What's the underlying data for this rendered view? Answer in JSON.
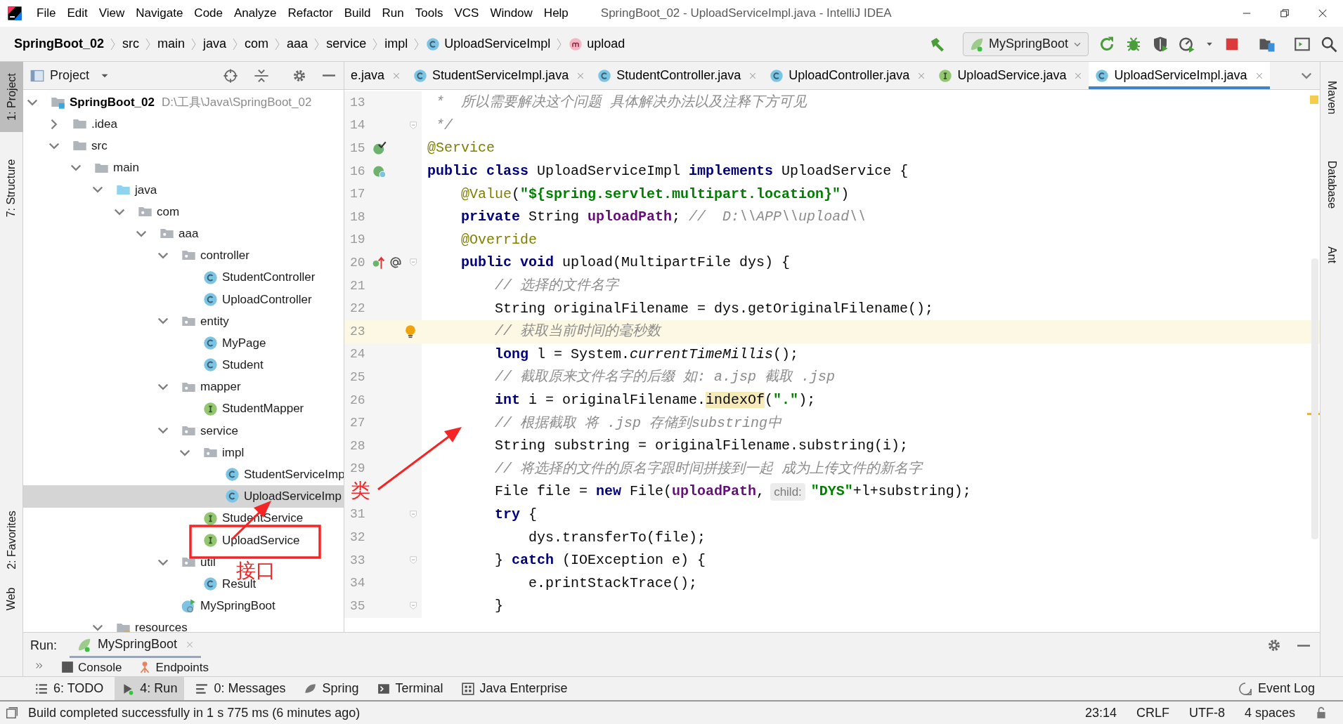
{
  "window": {
    "title": "SpringBoot_02 - UploadServiceImpl.java - IntelliJ IDEA"
  },
  "menu": [
    "File",
    "Edit",
    "View",
    "Navigate",
    "Code",
    "Analyze",
    "Refactor",
    "Build",
    "Run",
    "Tools",
    "VCS",
    "Window",
    "Help"
  ],
  "breadcrumbs": [
    {
      "label": "SpringBoot_02",
      "kind": "project"
    },
    {
      "label": "src",
      "kind": "folder"
    },
    {
      "label": "main",
      "kind": "folder"
    },
    {
      "label": "java",
      "kind": "folder"
    },
    {
      "label": "com",
      "kind": "folder"
    },
    {
      "label": "aaa",
      "kind": "folder"
    },
    {
      "label": "service",
      "kind": "folder"
    },
    {
      "label": "impl",
      "kind": "folder"
    },
    {
      "label": "UploadServiceImpl",
      "kind": "class"
    },
    {
      "label": "upload",
      "kind": "method"
    }
  ],
  "run_config": "MySpringBoot",
  "left_tool_tabs": [
    {
      "label": "1: Project",
      "selected": true
    },
    {
      "label": "7: Structure",
      "selected": false
    },
    {
      "label": "2: Favorites",
      "selected": false
    },
    {
      "label": "Web",
      "selected": false
    }
  ],
  "right_tool_tabs": [
    "Maven",
    "Database",
    "Ant"
  ],
  "project_panel": {
    "title": "Project",
    "tree": [
      {
        "label": "SpringBoot_02",
        "path": "D:\\工具\\Java\\SpringBoot_02",
        "kind": "module",
        "expanded": true,
        "selected": false,
        "children": [
          {
            "label": ".idea",
            "kind": "folder",
            "expanded": false,
            "selected": false
          },
          {
            "label": "src",
            "kind": "folder",
            "expanded": true,
            "selected": false,
            "children": [
              {
                "label": "main",
                "kind": "folder",
                "expanded": true,
                "selected": false,
                "children": [
                  {
                    "label": "java",
                    "kind": "source_folder",
                    "expanded": true,
                    "selected": false,
                    "children": [
                      {
                        "label": "com",
                        "kind": "package",
                        "expanded": true,
                        "selected": false,
                        "children": [
                          {
                            "label": "aaa",
                            "kind": "package",
                            "expanded": true,
                            "selected": false,
                            "children": [
                              {
                                "label": "controller",
                                "kind": "package",
                                "expanded": true,
                                "selected": false,
                                "children": [
                                  {
                                    "label": "StudentController",
                                    "kind": "class",
                                    "selected": false
                                  },
                                  {
                                    "label": "UploadController",
                                    "kind": "class",
                                    "selected": false
                                  }
                                ]
                              },
                              {
                                "label": "entity",
                                "kind": "package",
                                "expanded": true,
                                "selected": false,
                                "children": [
                                  {
                                    "label": "MyPage",
                                    "kind": "class",
                                    "selected": false
                                  },
                                  {
                                    "label": "Student",
                                    "kind": "class",
                                    "selected": false
                                  }
                                ]
                              },
                              {
                                "label": "mapper",
                                "kind": "package",
                                "expanded": true,
                                "selected": false,
                                "children": [
                                  {
                                    "label": "StudentMapper",
                                    "kind": "interface",
                                    "selected": false
                                  }
                                ]
                              },
                              {
                                "label": "service",
                                "kind": "package",
                                "expanded": true,
                                "selected": false,
                                "children": [
                                  {
                                    "label": "impl",
                                    "kind": "package",
                                    "expanded": true,
                                    "selected": false,
                                    "children": [
                                      {
                                        "label": "StudentServiceImp",
                                        "kind": "class",
                                        "selected": false
                                      },
                                      {
                                        "label": "UploadServiceImp",
                                        "kind": "class",
                                        "selected": true
                                      }
                                    ]
                                  },
                                  {
                                    "label": "StudentService",
                                    "kind": "interface",
                                    "selected": false
                                  },
                                  {
                                    "label": "UploadService",
                                    "kind": "interface",
                                    "selected": false
                                  }
                                ]
                              },
                              {
                                "label": "util",
                                "kind": "package",
                                "expanded": true,
                                "selected": false,
                                "children": [
                                  {
                                    "label": "Result",
                                    "kind": "class",
                                    "selected": false
                                  }
                                ]
                              },
                              {
                                "label": "MySpringBoot",
                                "kind": "spring_app",
                                "selected": false
                              }
                            ]
                          }
                        ]
                      }
                    ]
                  },
                  {
                    "label": "resources",
                    "kind": "resource_folder",
                    "expanded": true,
                    "selected": false
                  }
                ]
              }
            ]
          }
        ]
      }
    ]
  },
  "editor": {
    "tabs": [
      {
        "label": "e.java",
        "kind": "plain",
        "selected": false
      },
      {
        "label": "StudentServiceImpl.java",
        "kind": "class",
        "selected": false
      },
      {
        "label": "StudentController.java",
        "kind": "class",
        "selected": false
      },
      {
        "label": "UploadController.java",
        "kind": "class",
        "selected": false
      },
      {
        "label": "UploadService.java",
        "kind": "interface",
        "selected": false
      },
      {
        "label": "UploadServiceImpl.java",
        "kind": "class",
        "selected": true
      }
    ],
    "lines": [
      {
        "number": "13",
        "kind": "plain",
        "fold": false,
        "current": false,
        "tokens": [
          {
            "kind": "comment",
            "text": " *  所以需要解决这个问题 具体解决办法以及注释下方可见"
          }
        ]
      },
      {
        "number": "14",
        "kind": "plain",
        "fold": true,
        "current": false,
        "tokens": [
          {
            "kind": "comment",
            "text": " */"
          }
        ]
      },
      {
        "number": "15",
        "kind": "bean",
        "fold": false,
        "current": false,
        "tokens": [
          {
            "kind": "annotation",
            "text": "@Service"
          }
        ]
      },
      {
        "number": "16",
        "kind": "bean_class",
        "fold": false,
        "current": false,
        "tokens": [
          {
            "kind": "keyword",
            "text": "public"
          },
          {
            "kind": "keyword",
            "text": " class"
          },
          {
            "kind": "plain",
            "text": " UploadServiceImpl "
          },
          {
            "kind": "keyword",
            "text": "implements"
          },
          {
            "kind": "plain",
            "text": " UploadService {"
          }
        ]
      },
      {
        "number": "17",
        "kind": "plain",
        "fold": false,
        "current": false,
        "tokens": [
          {
            "kind": "annotation",
            "text": "    @Value"
          },
          {
            "kind": "plain",
            "text": "("
          },
          {
            "kind": "string",
            "text": "\"${spring.servlet.multipart.location}\""
          },
          {
            "kind": "plain",
            "text": ")"
          }
        ]
      },
      {
        "number": "18",
        "kind": "plain",
        "fold": false,
        "current": false,
        "tokens": [
          {
            "kind": "keyword",
            "text": "    private"
          },
          {
            "kind": "plain",
            "text": " String "
          },
          {
            "kind": "field",
            "text": "uploadPath"
          },
          {
            "kind": "plain",
            "text": "; "
          },
          {
            "kind": "comment",
            "text": "//  D:\\\\APP\\\\upload\\\\"
          }
        ]
      },
      {
        "number": "19",
        "kind": "plain",
        "fold": false,
        "current": false,
        "tokens": [
          {
            "kind": "annotation",
            "text": "    @Override"
          }
        ]
      },
      {
        "number": "20",
        "kind": "implements",
        "fold": true,
        "current": false,
        "tokens": [
          {
            "kind": "keyword",
            "text": "    public"
          },
          {
            "kind": "keyword",
            "text": " void"
          },
          {
            "kind": "plain",
            "text": " upload(MultipartFile dys) {"
          }
        ]
      },
      {
        "number": "21",
        "kind": "plain",
        "fold": false,
        "current": false,
        "tokens": [
          {
            "kind": "comment",
            "text": "        // 选择的文件名字"
          }
        ]
      },
      {
        "number": "22",
        "kind": "plain",
        "fold": false,
        "current": false,
        "tokens": [
          {
            "kind": "plain",
            "text": "        String originalFilename = dys.getOriginalFilename();"
          }
        ]
      },
      {
        "number": "23",
        "kind": "bulb",
        "fold": false,
        "current": true,
        "tokens": [
          {
            "kind": "comment",
            "text": "        // 获取当前时间的毫秒数"
          }
        ]
      },
      {
        "number": "24",
        "kind": "plain",
        "fold": false,
        "current": false,
        "tokens": [
          {
            "kind": "keyword",
            "text": "        long"
          },
          {
            "kind": "plain",
            "text": " l = System."
          },
          {
            "kind": "static",
            "text": "currentTimeMillis"
          },
          {
            "kind": "plain",
            "text": "();"
          }
        ]
      },
      {
        "number": "25",
        "kind": "plain",
        "fold": false,
        "current": false,
        "tokens": [
          {
            "kind": "comment",
            "text": "        // 截取原来文件名字的后缀 如: a.jsp 截取 .jsp"
          }
        ]
      },
      {
        "number": "26",
        "kind": "plain",
        "fold": false,
        "current": false,
        "tokens": [
          {
            "kind": "keyword",
            "text": "        int"
          },
          {
            "kind": "plain",
            "text": " i = originalFilename."
          },
          {
            "kind": "highlight",
            "text": "indexOf"
          },
          {
            "kind": "plain",
            "text": "("
          },
          {
            "kind": "string",
            "text": "\".\""
          },
          {
            "kind": "plain",
            "text": ");"
          }
        ]
      },
      {
        "number": "27",
        "kind": "plain",
        "fold": false,
        "current": false,
        "tokens": [
          {
            "kind": "comment",
            "text": "        // 根据截取 将 .jsp 存储到substring中"
          }
        ]
      },
      {
        "number": "28",
        "kind": "plain",
        "fold": false,
        "current": false,
        "tokens": [
          {
            "kind": "plain",
            "text": "        String substring = originalFilename.substring(i);"
          }
        ]
      },
      {
        "number": "29",
        "kind": "plain",
        "fold": false,
        "current": false,
        "tokens": [
          {
            "kind": "comment",
            "text": "        // 将选择的文件的原名字跟时间拼接到一起 成为上传文件的新名字"
          }
        ]
      },
      {
        "kind": "plain",
        "fold": false,
        "current": false,
        "tokens": [
          {
            "kind": "plain",
            "text": "        File file = "
          },
          {
            "kind": "keyword",
            "text": "new"
          },
          {
            "kind": "plain",
            "text": " File("
          },
          {
            "kind": "field",
            "text": "uploadPath"
          },
          {
            "kind": "plain",
            "text": ","
          },
          {
            "kind": "hint",
            "text": "child:"
          },
          {
            "kind": "string",
            "text": "\"DYS\""
          },
          {
            "kind": "plain",
            "text": "+l+substring);"
          }
        ]
      },
      {
        "number": "31",
        "kind": "plain",
        "fold": true,
        "current": false,
        "tokens": [
          {
            "kind": "keyword",
            "text": "        try"
          },
          {
            "kind": "plain",
            "text": " {"
          }
        ]
      },
      {
        "number": "32",
        "kind": "plain",
        "fold": false,
        "current": false,
        "tokens": [
          {
            "kind": "plain",
            "text": "            dys.transferTo(file);"
          }
        ]
      },
      {
        "number": "33",
        "kind": "plain",
        "fold": true,
        "current": false,
        "tokens": [
          {
            "kind": "plain",
            "text": "        } "
          },
          {
            "kind": "keyword",
            "text": "catch"
          },
          {
            "kind": "plain",
            "text": " (IOException e) {"
          }
        ]
      },
      {
        "number": "34",
        "kind": "plain",
        "fold": false,
        "current": false,
        "tokens": [
          {
            "kind": "plain",
            "text": "            e.printStackTrace();"
          }
        ]
      },
      {
        "number": "35",
        "kind": "plain",
        "fold": true,
        "current": false,
        "tokens": [
          {
            "kind": "plain",
            "text": "        }"
          }
        ]
      }
    ]
  },
  "run_panel": {
    "label": "Run:",
    "tab": "MySpringBoot",
    "subtabs": [
      "Console",
      "Endpoints"
    ]
  },
  "tool_bar": [
    {
      "label": "6: TODO",
      "kind": "list",
      "selected": false
    },
    {
      "label": "4: Run",
      "kind": "run",
      "selected": true
    },
    {
      "label": "0: Messages",
      "kind": "messages",
      "selected": false
    },
    {
      "label": "Spring",
      "kind": "spring",
      "selected": false
    },
    {
      "label": "Terminal",
      "kind": "terminal",
      "selected": false
    },
    {
      "label": "Java Enterprise",
      "kind": "enterprise",
      "selected": false
    }
  ],
  "event_log": "Event Log",
  "status_bar": {
    "message": "Build completed successfully in 1 s 775 ms (6 minutes ago)",
    "position": "23:14",
    "line_separator": "CRLF",
    "encoding": "UTF-8",
    "indent": "4 spaces"
  },
  "annotations": [
    {
      "kind": "label",
      "text": "接口"
    },
    {
      "kind": "label",
      "text": "类"
    }
  ]
}
